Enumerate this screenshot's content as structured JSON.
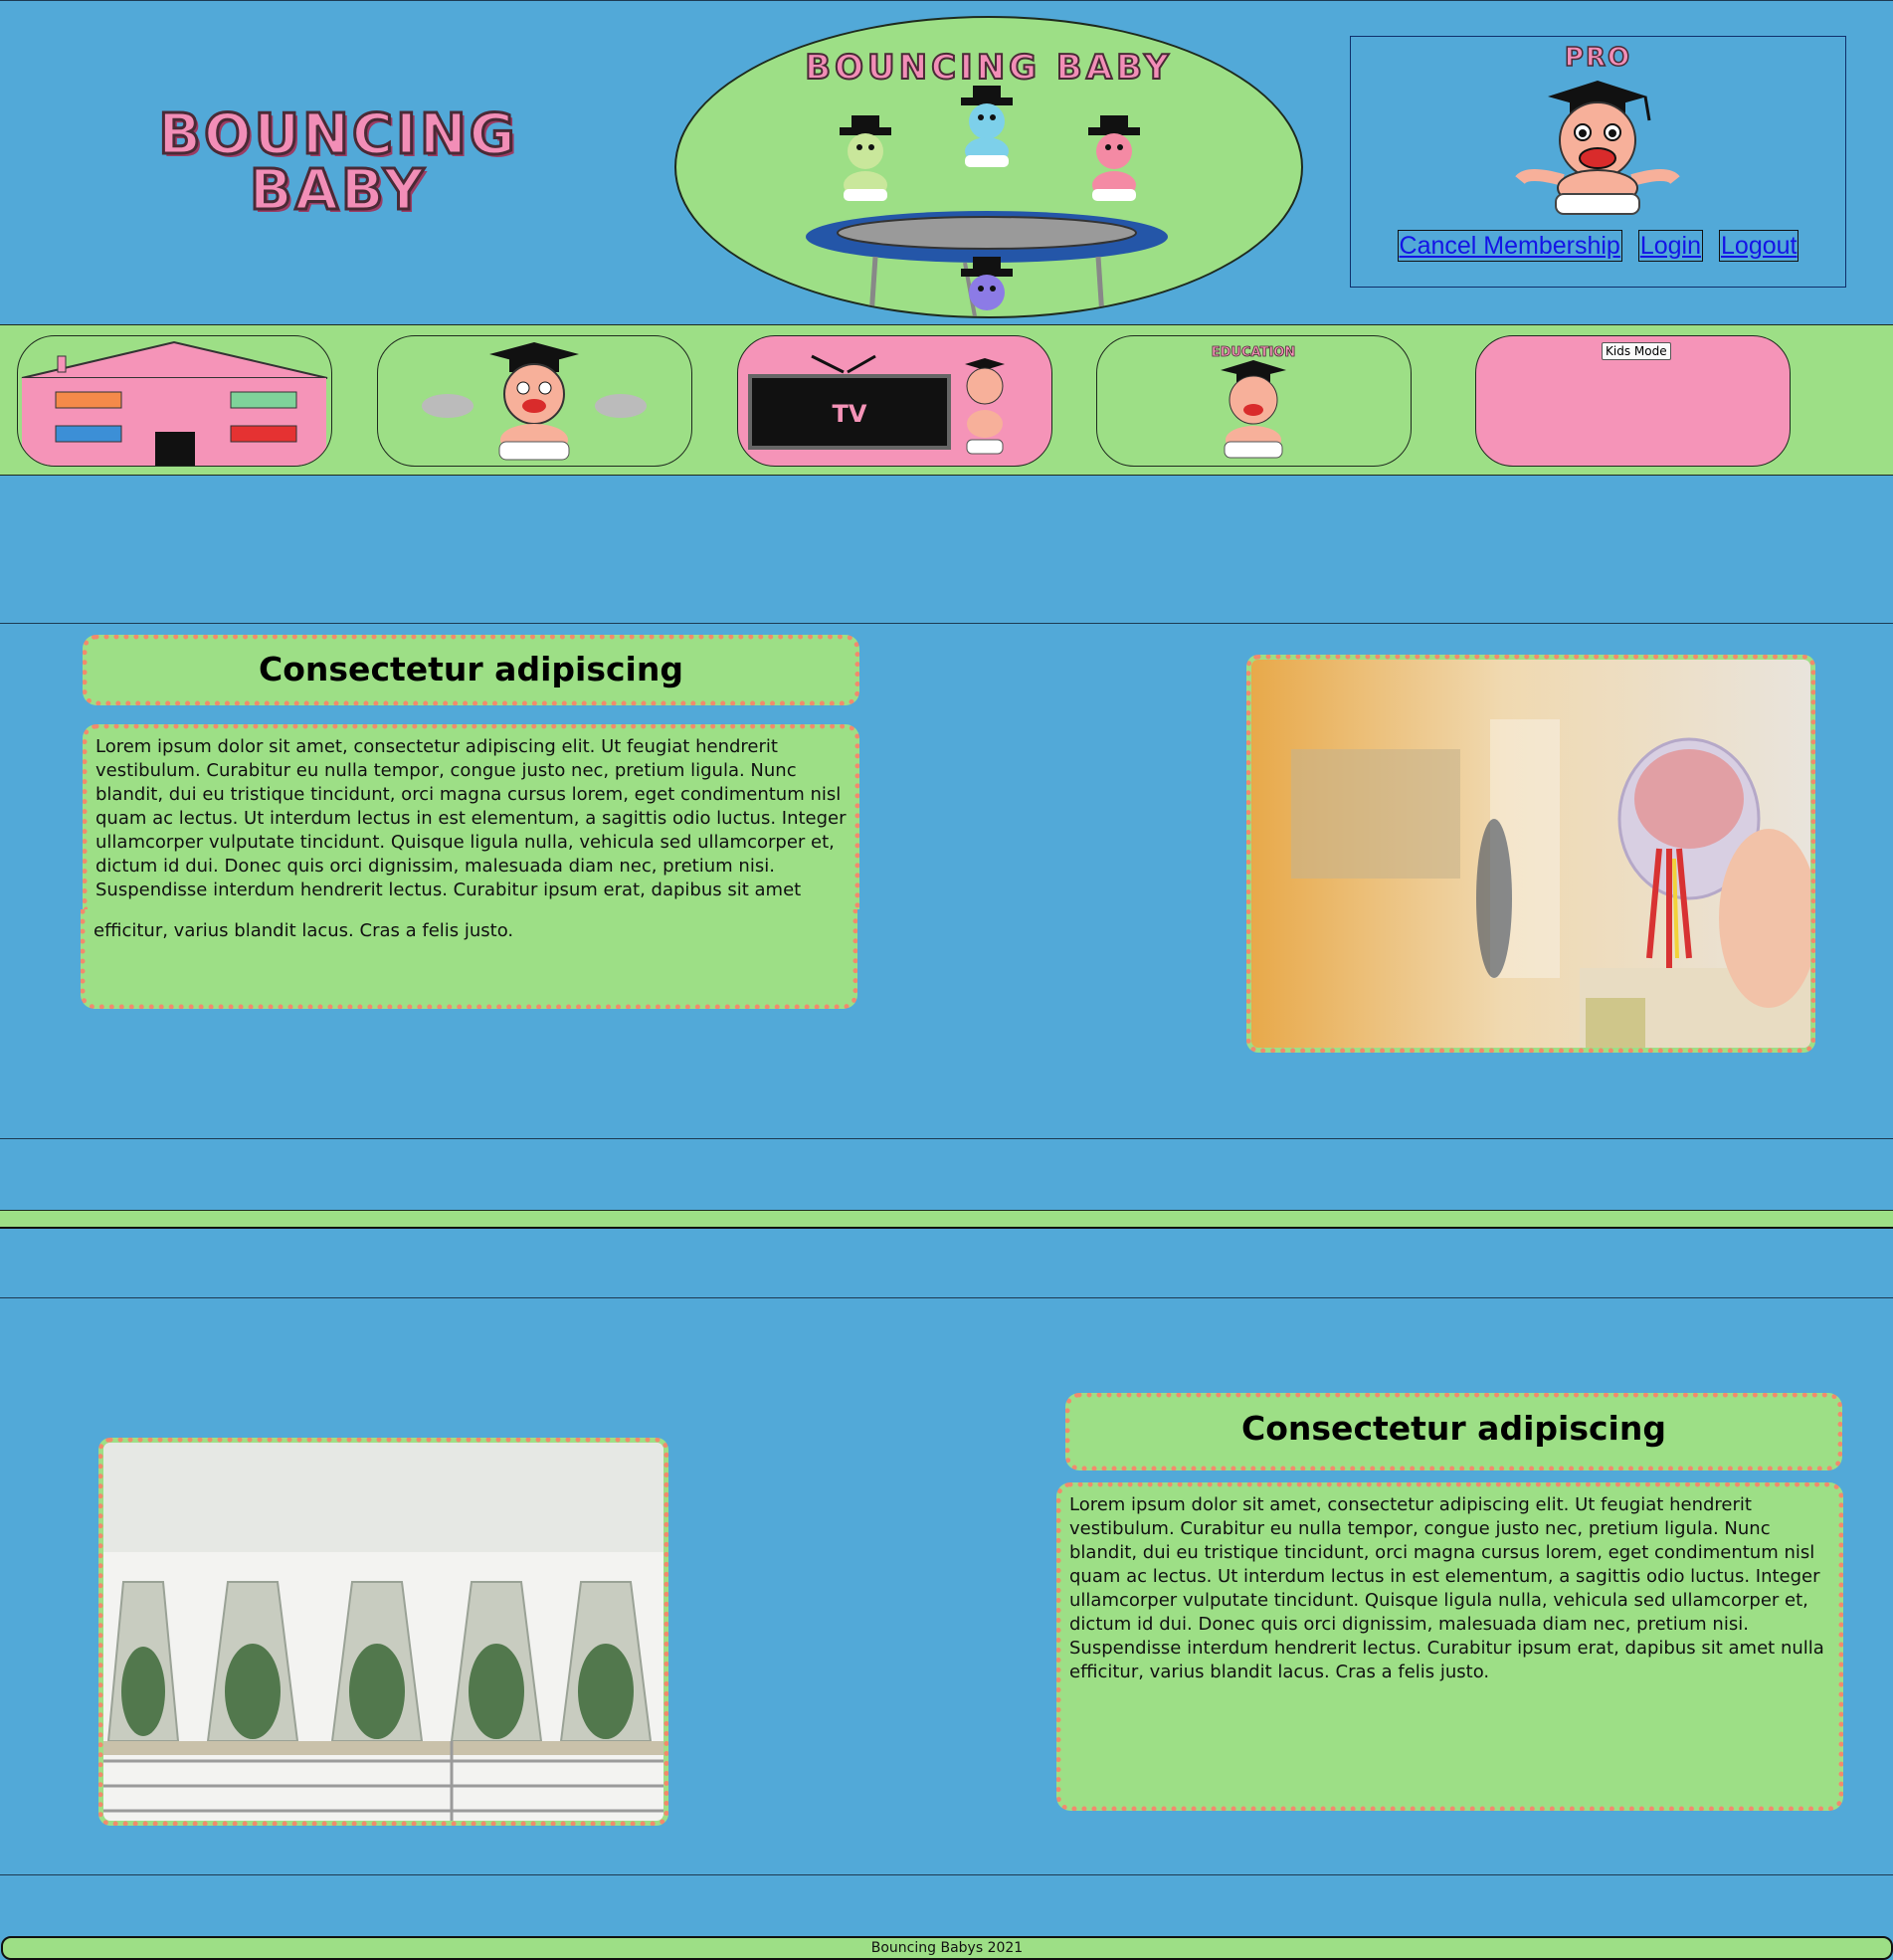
{
  "header": {
    "logo_line1": "BOUNCING",
    "logo_line2": "BABY",
    "oval_title": "BOUNCING BABY",
    "pro_label": "PRO",
    "links": {
      "cancel": "Cancel Membership",
      "login": "Login",
      "logout": "Logout"
    }
  },
  "nav": {
    "tiles": [
      {
        "name": "home"
      },
      {
        "name": "baby"
      },
      {
        "name": "tv",
        "label": "TV"
      },
      {
        "name": "education",
        "label": "EDUCATION"
      },
      {
        "name": "kids-mode"
      }
    ],
    "kids_mode_label": "Kids Mode"
  },
  "section1": {
    "title": "Consectetur adipiscing",
    "body": "Lorem ipsum dolor sit amet, consectetur adipiscing elit. Ut feugiat hendrerit vestibulum. Curabitur eu nulla tempor, congue justo nec, pretium ligula. Nunc blandit, dui eu tristique tincidunt, orci magna cursus lorem, eget condimentum nisl quam ac lectus. Ut interdum lectus in est elementum, a sagittis odio luctus. Integer ullamcorper vulputate tincidunt. Quisque ligula nulla, vehicula sed ullamcorper et, dictum id dui. Donec quis orci dignissim, malesuada diam nec, pretium nisi. Suspendisse interdum hendrerit lectus. Curabitur ipsum erat, dapibus sit amet nulla",
    "overflow": "efficitur, varius blandit lacus. Cras a felis justo."
  },
  "section2": {
    "title": "Consectetur adipiscing",
    "body": "Lorem ipsum dolor sit amet, consectetur adipiscing elit. Ut feugiat hendrerit vestibulum. Curabitur eu nulla tempor, congue justo nec, pretium ligula. Nunc blandit, dui eu tristique tincidunt, orci magna cursus lorem, eget condimentum nisl quam ac lectus. Ut interdum lectus in est elementum, a sagittis odio luctus. Integer ullamcorper vulputate tincidunt. Quisque ligula nulla, vehicula sed ullamcorper et, dictum id dui. Donec quis orci dignissim, malesuada diam nec, pretium nisi. Suspendisse interdum hendrerit lectus. Curabitur ipsum erat, dapibus sit amet nulla efficitur, varius blandit lacus. Cras a felis justo."
  },
  "footer": {
    "text": "Bouncing Babys 2021"
  },
  "colors": {
    "background": "#52a9d8",
    "green": "#9ddf86",
    "pink": "#f594b8",
    "dot_border": "#f28a6d",
    "link": "#1414e6"
  }
}
